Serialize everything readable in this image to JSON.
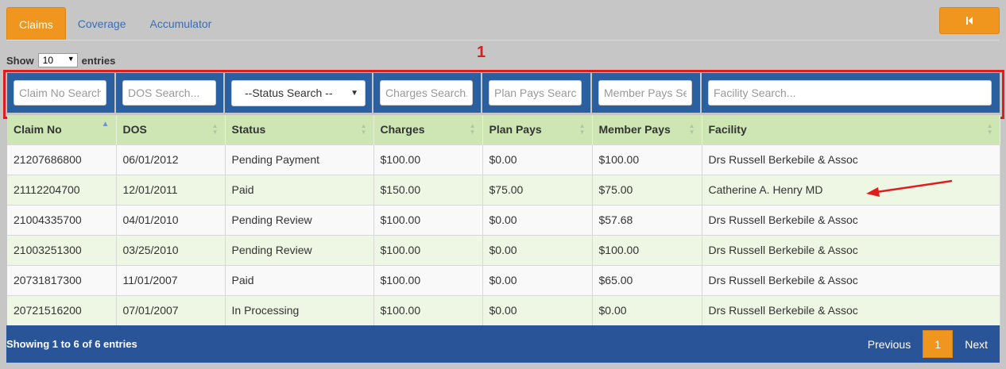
{
  "tabs": [
    {
      "label": "Claims"
    },
    {
      "label": "Coverage"
    },
    {
      "label": "Accumulator"
    }
  ],
  "back_icon": "skip-back-icon",
  "length": {
    "show": "Show",
    "value": "10",
    "entries": "entries"
  },
  "annotation": "1",
  "filters": {
    "claim_no": "Claim No Search",
    "dos": "DOS Search...",
    "status": "--Status Search --",
    "charges": "Charges Search...",
    "plan_pays": "Plan Pays Search...",
    "member_pays": "Member Pays Search...",
    "facility": "Facility Search..."
  },
  "columns": [
    "Claim No",
    "DOS",
    "Status",
    "Charges",
    "Plan Pays",
    "Member Pays",
    "Facility"
  ],
  "rows": [
    [
      "21207686800",
      "06/01/2012",
      "Pending Payment",
      "$100.00",
      "$0.00",
      "$100.00",
      "Drs Russell Berkebile & Assoc"
    ],
    [
      "21112204700",
      "12/01/2011",
      "Paid",
      "$150.00",
      "$75.00",
      "$75.00",
      "Catherine A. Henry MD"
    ],
    [
      "21004335700",
      "04/01/2010",
      "Pending Review",
      "$100.00",
      "$0.00",
      "$57.68",
      "Drs Russell Berkebile & Assoc"
    ],
    [
      "21003251300",
      "03/25/2010",
      "Pending Review",
      "$100.00",
      "$0.00",
      "$100.00",
      "Drs Russell Berkebile & Assoc"
    ],
    [
      "20731817300",
      "11/01/2007",
      "Paid",
      "$100.00",
      "$0.00",
      "$65.00",
      "Drs Russell Berkebile & Assoc"
    ],
    [
      "20721516200",
      "07/01/2007",
      "In Processing",
      "$100.00",
      "$0.00",
      "$0.00",
      "Drs Russell Berkebile & Assoc"
    ]
  ],
  "footer": {
    "info": "Showing 1 to 6 of 6 entries",
    "previous": "Previous",
    "page": "1",
    "next": "Next"
  },
  "colors": {
    "accent": "#f0961e",
    "header_blue": "#2a5fa0",
    "header_green": "#cde6b4",
    "annotation_red": "#e01c1c"
  }
}
